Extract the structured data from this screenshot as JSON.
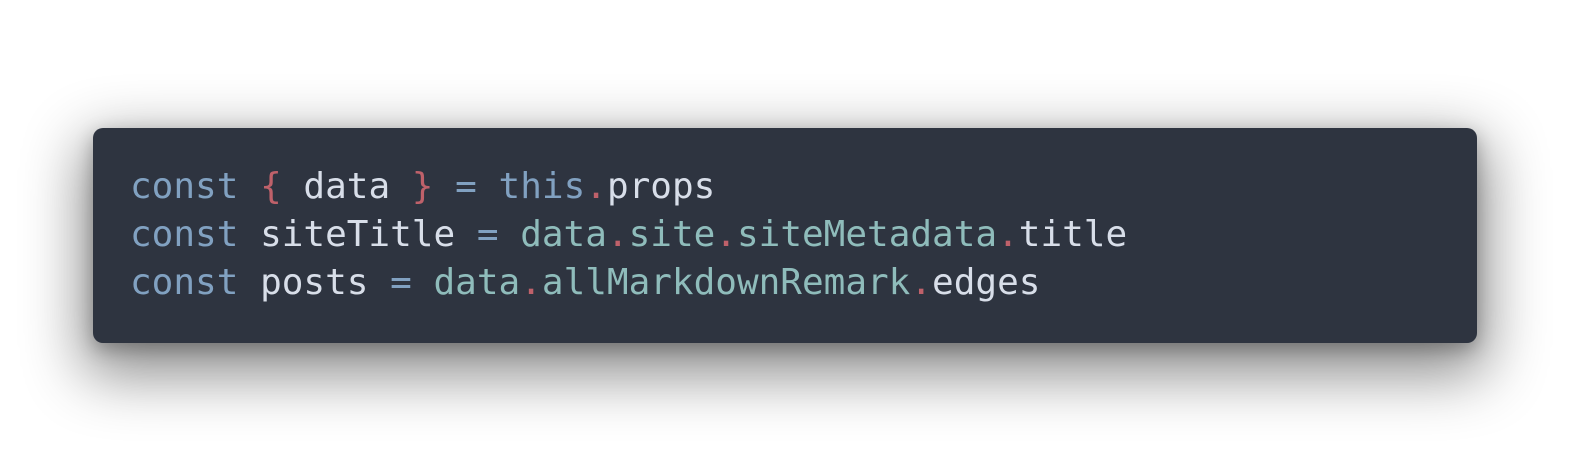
{
  "colors": {
    "background": "#ffffff",
    "panel": "#2e3440",
    "keyword": "#81a1c1",
    "punctuation": "#bf616a",
    "identifier": "#d8dee9",
    "object": "#8fbcbb"
  },
  "code": {
    "lines": [
      {
        "tokens": [
          {
            "text": "const",
            "kind": "keyword"
          },
          {
            "text": " ",
            "kind": "space"
          },
          {
            "text": "{",
            "kind": "brace"
          },
          {
            "text": " data ",
            "kind": "var"
          },
          {
            "text": "}",
            "kind": "brace"
          },
          {
            "text": " ",
            "kind": "space"
          },
          {
            "text": "=",
            "kind": "op"
          },
          {
            "text": " ",
            "kind": "space"
          },
          {
            "text": "this",
            "kind": "keyword"
          },
          {
            "text": ".",
            "kind": "dot"
          },
          {
            "text": "props",
            "kind": "prop"
          }
        ]
      },
      {
        "tokens": [
          {
            "text": "const",
            "kind": "keyword"
          },
          {
            "text": " ",
            "kind": "space"
          },
          {
            "text": "siteTitle",
            "kind": "var"
          },
          {
            "text": " ",
            "kind": "space"
          },
          {
            "text": "=",
            "kind": "op"
          },
          {
            "text": " ",
            "kind": "space"
          },
          {
            "text": "data",
            "kind": "obj"
          },
          {
            "text": ".",
            "kind": "dot"
          },
          {
            "text": "site",
            "kind": "obj"
          },
          {
            "text": ".",
            "kind": "dot"
          },
          {
            "text": "siteMetadata",
            "kind": "obj"
          },
          {
            "text": ".",
            "kind": "dot"
          },
          {
            "text": "title",
            "kind": "prop"
          }
        ]
      },
      {
        "tokens": [
          {
            "text": "const",
            "kind": "keyword"
          },
          {
            "text": " ",
            "kind": "space"
          },
          {
            "text": "posts",
            "kind": "var"
          },
          {
            "text": " ",
            "kind": "space"
          },
          {
            "text": "=",
            "kind": "op"
          },
          {
            "text": " ",
            "kind": "space"
          },
          {
            "text": "data",
            "kind": "obj"
          },
          {
            "text": ".",
            "kind": "dot"
          },
          {
            "text": "allMarkdownRemark",
            "kind": "obj"
          },
          {
            "text": ".",
            "kind": "dot"
          },
          {
            "text": "edges",
            "kind": "prop"
          }
        ]
      }
    ]
  }
}
